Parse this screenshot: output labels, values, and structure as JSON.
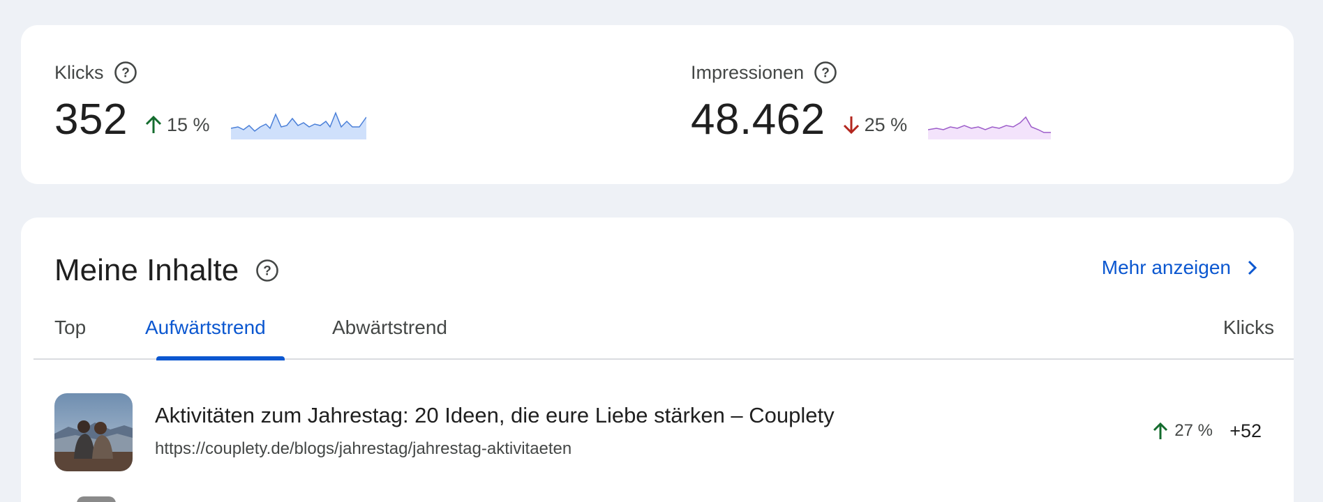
{
  "metrics": {
    "clicks": {
      "label": "Klicks",
      "value": "352",
      "delta_text": "15 %",
      "delta_direction": "up",
      "sparkline_color": "#4a7fd8",
      "sparkline_fill": "#cfe0fb"
    },
    "impressions": {
      "label": "Impressionen",
      "value": "48.462",
      "delta_text": "25 %",
      "delta_direction": "down",
      "sparkline_color": "#9c5cc9",
      "sparkline_fill": "#f3e3fb"
    }
  },
  "content": {
    "title": "Meine Inhalte",
    "more_label": "Mehr anzeigen",
    "tabs": [
      {
        "label": "Top"
      },
      {
        "label": "Aufwärtstrend",
        "selected": true
      },
      {
        "label": "Abwärtstrend"
      }
    ],
    "column_header": "Klicks",
    "rows": [
      {
        "title": "Aktivitäten zum Jahrestag: 20 Ideen, die eure Liebe stärken – Couplety",
        "url": "https://couplety.de/blogs/jahrestag/jahrestag-aktivitaeten",
        "delta_text": "27 %",
        "delta_direction": "up",
        "value": "+52"
      }
    ]
  },
  "colors": {
    "accent": "#0b57d0",
    "up": "#146c2e",
    "down": "#b3261e",
    "background": "#eef1f6"
  }
}
